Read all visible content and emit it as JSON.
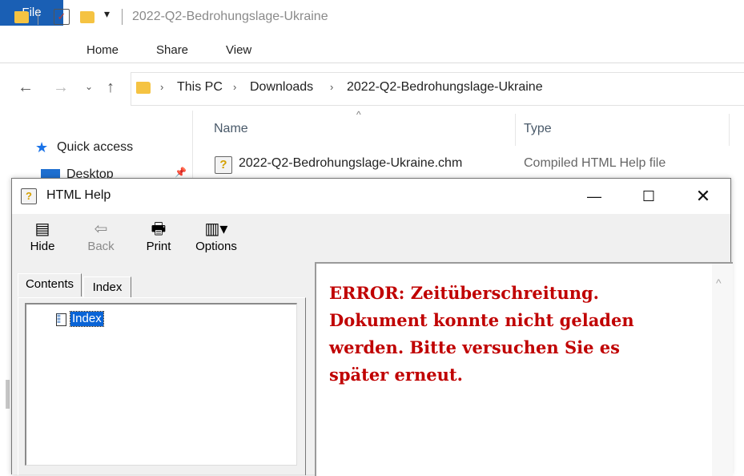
{
  "explorer": {
    "title": "2022-Q2-Bedrohungslage-Ukraine",
    "ribbon_tabs": [
      "File",
      "Home",
      "Share",
      "View"
    ],
    "breadcrumb": [
      "This PC",
      "Downloads",
      "2022-Q2-Bedrohungslage-Ukraine"
    ],
    "sidebar": {
      "quick_access": "Quick access",
      "desktop": "Desktop"
    },
    "columns": {
      "name": "Name",
      "type": "Type"
    },
    "file": {
      "name": "2022-Q2-Bedrohungslage-Ukraine.chm",
      "type": "Compiled HTML Help file"
    }
  },
  "help": {
    "title": "HTML Help",
    "toolbar": {
      "hide": "Hide",
      "back": "Back",
      "print": "Print",
      "options": "Options"
    },
    "tabs": {
      "contents": "Contents",
      "index": "Index"
    },
    "tree_item": "Index",
    "error_lines": [
      "ERROR: Zeitüberschreitung.",
      "Dokument konnte nicht geladen",
      "werden. Bitte versuchen Sie es",
      "später erneut."
    ]
  },
  "colors": {
    "accent": "#1a5fb4",
    "error": "#c00000",
    "selection": "#0a64d6"
  }
}
